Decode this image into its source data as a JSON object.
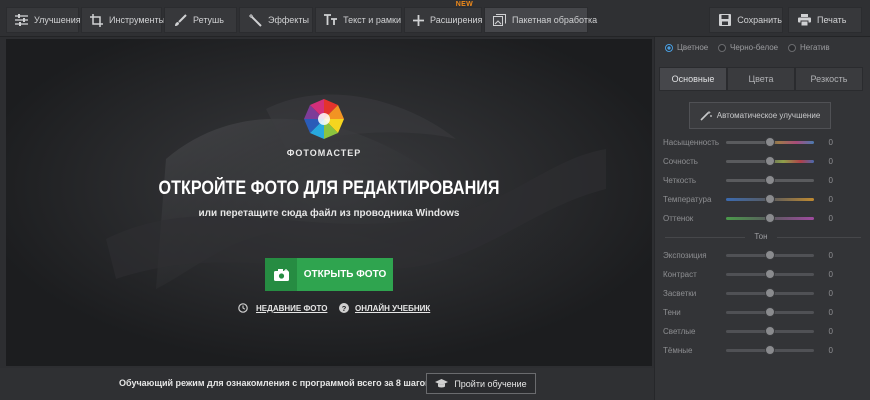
{
  "toolbar": {
    "items": [
      {
        "label": "Улучшения",
        "icon": "sliders-icon"
      },
      {
        "label": "Инструменты",
        "icon": "crop-icon"
      },
      {
        "label": "Ретушь",
        "icon": "brush-icon"
      },
      {
        "label": "Эффекты",
        "icon": "magic-wand-icon"
      },
      {
        "label": "Текст и рамки",
        "icon": "text-icon"
      },
      {
        "label": "Расширения",
        "icon": "plus-icon",
        "badge": "NEW"
      },
      {
        "label": "Пакетная обработка",
        "icon": "batch-icon"
      }
    ],
    "save_label": "Сохранить",
    "print_label": "Печать"
  },
  "welcome": {
    "brand": "ФОТОМАСТЕР",
    "title": "ОТКРОЙТЕ ФОТО ДЛЯ РЕДАКТИРОВАНИЯ",
    "subtitle": "или перетащите сюда файл из проводника Windows",
    "open_button": "ОТКРЫТЬ ФОТО",
    "recent_link": "НЕДАВНИЕ ФОТО",
    "tutorial_link": "ОНЛАЙН УЧЕБНИК"
  },
  "bottom_bar": {
    "text": "Обучающий режим для ознакомления с программой всего за 8 шагов!",
    "button": "Пройти обучение"
  },
  "panel": {
    "color_modes": [
      {
        "label": "Цветное",
        "selected": true
      },
      {
        "label": "Черно-белое",
        "selected": false
      },
      {
        "label": "Негатив",
        "selected": false
      }
    ],
    "tabs": [
      {
        "label": "Основные",
        "active": true
      },
      {
        "label": "Цвета",
        "active": false
      },
      {
        "label": "Резкость",
        "active": false
      }
    ],
    "auto_button": "Автоматическое улучшение",
    "tone_heading": "Тон",
    "color_sliders": [
      {
        "label": "Насыщенность",
        "value": "0"
      },
      {
        "label": "Сочность",
        "value": "0"
      },
      {
        "label": "Четкость",
        "value": "0"
      },
      {
        "label": "Температура",
        "value": "0"
      },
      {
        "label": "Оттенок",
        "value": "0"
      }
    ],
    "tone_sliders": [
      {
        "label": "Экспозиция",
        "value": "0"
      },
      {
        "label": "Контраст",
        "value": "0"
      },
      {
        "label": "Засветки",
        "value": "0"
      },
      {
        "label": "Тени",
        "value": "0"
      },
      {
        "label": "Светлые",
        "value": "0"
      },
      {
        "label": "Тёмные",
        "value": "0"
      }
    ]
  },
  "colors": {
    "accent_green": "#2fa44f",
    "radio_blue": "#4a9ee0",
    "badge_orange": "#f08a1a"
  }
}
